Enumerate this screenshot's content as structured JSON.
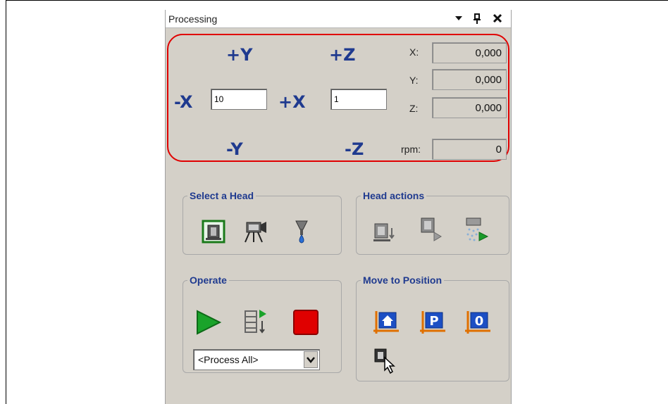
{
  "window": {
    "title": "Processing",
    "menu_icon": "dropdown-arrow-icon",
    "pin_icon": "pin-icon",
    "close_icon": "close-icon"
  },
  "jog": {
    "plus_y": "+Y",
    "minus_y": "-Y",
    "plus_x": "+X",
    "minus_x": "-X",
    "plus_z": "+Z",
    "minus_z": "-Z",
    "xy_step": "10",
    "z_step": "1",
    "highlight_color": "#e00000",
    "axis_color": "#1f3a8f"
  },
  "coords": {
    "x_label": "X:",
    "x_value": "0,000",
    "y_label": "Y:",
    "y_value": "0,000",
    "z_label": "Z:",
    "z_value": "0,000",
    "rpm_label": "rpm:",
    "rpm_value": "0"
  },
  "select_head": {
    "legend": "Select a Head",
    "icons": [
      "spindle-head-icon",
      "camera-head-icon",
      "dispenser-head-icon"
    ]
  },
  "head_actions": {
    "legend": "Head actions",
    "icons": [
      "head-down-icon",
      "head-run-icon",
      "head-spray-icon"
    ]
  },
  "operate": {
    "legend": "Operate",
    "icons": [
      "play-icon",
      "step-icon",
      "stop-icon"
    ],
    "process_select": "<Process All>"
  },
  "move_to_position": {
    "legend": "Move to Position",
    "icons": [
      "home-position-icon",
      "park-position-icon",
      "zero-position-icon",
      "head-pointer-icon"
    ]
  }
}
